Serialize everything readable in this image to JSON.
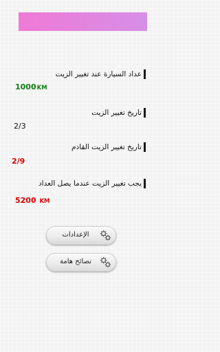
{
  "colors": {
    "banner_start": "#ef7ad6",
    "banner_end": "#d68ee6",
    "odometer_value": "#0f7d12",
    "next_date_value": "#e00000",
    "target_value": "#e00000"
  },
  "fields": {
    "odometer": {
      "label": "عداد السيارة عند تغيير الزيت",
      "value": "1000",
      "unit": "KM"
    },
    "last_change_date": {
      "label": "تاريخ تغيير الزيت",
      "value": "2/3"
    },
    "next_change_date": {
      "label": "تاريخ تغيير الزيت القادم",
      "value": "2/9"
    },
    "target_odometer": {
      "label": "يجب تغيير الزيت عندما يصل العداد",
      "value": "5200",
      "unit": "KM"
    }
  },
  "buttons": {
    "settings": {
      "label": "الإعدادات",
      "icon": "gears-icon"
    },
    "tips": {
      "label": "نصائح هامة",
      "icon": "gears-icon"
    }
  }
}
